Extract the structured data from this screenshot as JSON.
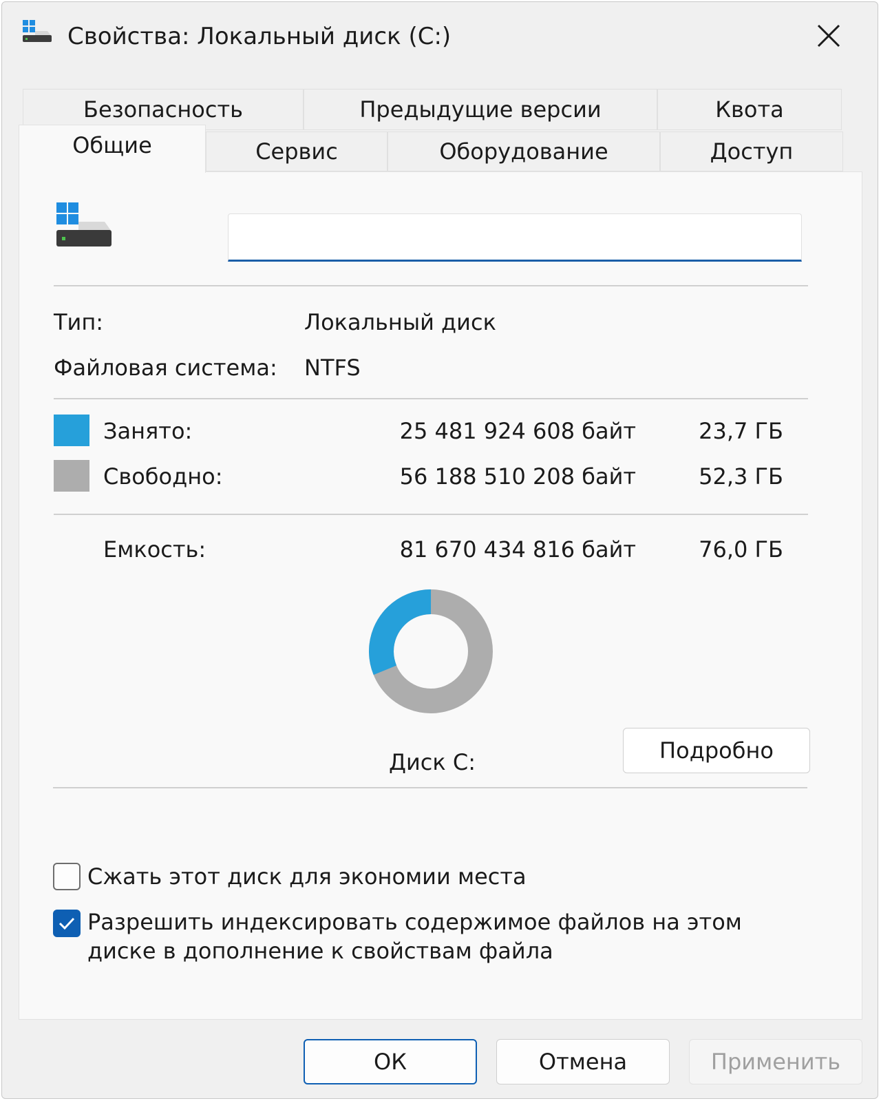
{
  "window": {
    "title": "Свойства: Локальный диск (C:)",
    "icon": "drive-icon",
    "close_icon": "close-icon"
  },
  "tabs_row1": [
    {
      "label": "Безопасность"
    },
    {
      "label": "Предыдущие версии"
    },
    {
      "label": "Квота"
    }
  ],
  "tabs_row2": [
    {
      "label": "Общие",
      "active": true
    },
    {
      "label": "Сервис"
    },
    {
      "label": "Оборудование"
    },
    {
      "label": "Доступ"
    }
  ],
  "general": {
    "name_value": "",
    "type_label": "Тип:",
    "type_value": "Локальный диск",
    "fs_label": "Файловая система:",
    "fs_value": "NTFS",
    "used_label": "Занято:",
    "used_bytes": "25 481 924 608 байт",
    "used_gb": "23,7 ГБ",
    "free_label": "Свободно:",
    "free_bytes": "56 188 510 208 байт",
    "free_gb": "52,3 ГБ",
    "capacity_label": "Емкость:",
    "capacity_bytes": "81 670 434 816 байт",
    "capacity_gb": "76,0 ГБ",
    "used_fraction": 0.312,
    "used_color": "#26a0da",
    "free_color": "#adadad",
    "drive_label": "Диск C:",
    "details_button": "Подробно",
    "compress_label": "Сжать этот диск для экономии места",
    "compress_checked": false,
    "index_label_line1": "Разрешить индексировать содержимое файлов на этом",
    "index_label_line2": "диске в дополнение к свойствам файла",
    "index_checked": true
  },
  "footer": {
    "ok": "ОК",
    "cancel": "Отмена",
    "apply": "Применить"
  }
}
